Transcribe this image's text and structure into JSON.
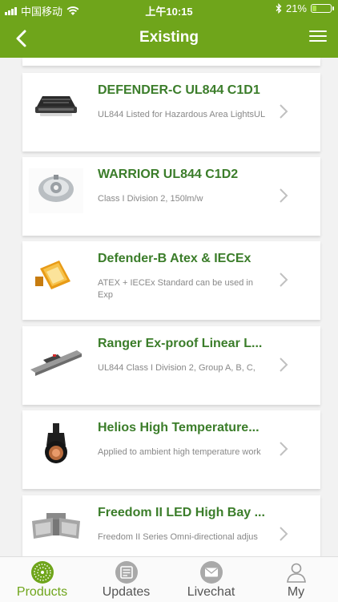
{
  "status_bar": {
    "carrier": "中国移动",
    "time": "上午10:15",
    "battery": "21%"
  },
  "nav": {
    "title": "Existing"
  },
  "products": [
    {
      "name": "DEFENDER-C UL844 C1D1",
      "description": "UL844 Listed for Hazardous Area LightsUL"
    },
    {
      "name": "WARRIOR UL844 C1D2",
      "description": "Class I Division 2, 150lm/w"
    },
    {
      "name": "Defender-B Atex & IECEx",
      "description": "ATEX + IECEx Standard can be used in Exp"
    },
    {
      "name": "Ranger Ex-proof Linear L...",
      "description": "UL844 Class I Division 2, Group A, B, C,"
    },
    {
      "name": "Helios High Temperature...",
      "description": "Applied to ambient high temperature work"
    },
    {
      "name": "Freedom II LED High Bay ...",
      "description": "Freedom II Series Omni-directional adjus"
    }
  ],
  "tabs": [
    {
      "label": "Products",
      "icon": "products-icon",
      "active": true
    },
    {
      "label": "Updates",
      "icon": "updates-icon",
      "active": false
    },
    {
      "label": "Livechat",
      "icon": "livechat-icon",
      "active": false
    },
    {
      "label": "My",
      "icon": "my-icon",
      "active": false
    }
  ],
  "colors": {
    "accent": "#6fa51b",
    "product_name": "#3b7d2a",
    "description": "#888888"
  }
}
